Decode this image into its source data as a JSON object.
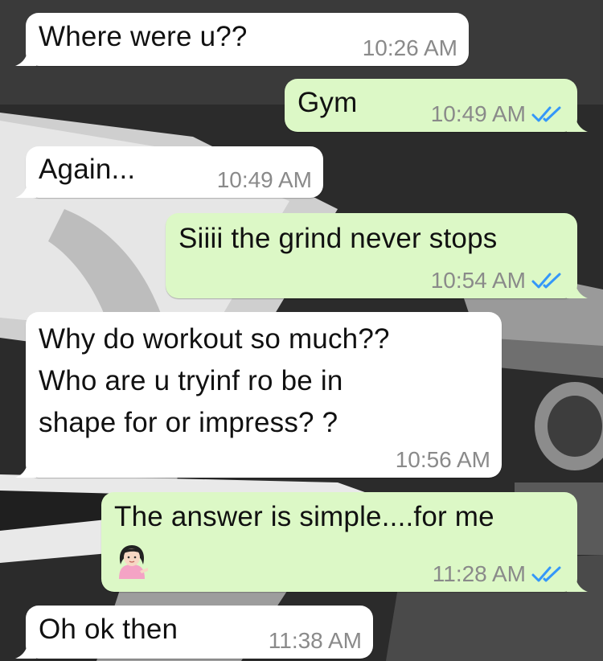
{
  "messages": [
    {
      "direction": "incoming",
      "text": "Where were u??",
      "time": "10:26 AM"
    },
    {
      "direction": "outgoing",
      "text": "Gym",
      "time": "10:49 AM",
      "status": "read"
    },
    {
      "direction": "incoming",
      "text": "Again...",
      "time": "10:49 AM"
    },
    {
      "direction": "outgoing",
      "text": "Siiii the grind never stops",
      "time": "10:54 AM",
      "status": "read"
    },
    {
      "direction": "incoming",
      "lines": [
        "Why do workout so much??",
        "Who are u tryinf ro be in",
        "shape for or impress? ?"
      ],
      "time": "10:56 AM"
    },
    {
      "direction": "outgoing",
      "text": "The answer is simple....for me",
      "emoji": "woman-tipping-hand-emoji",
      "time": "11:28 AM",
      "status": "read"
    },
    {
      "direction": "incoming",
      "text": "Oh ok then",
      "time": "11:38 AM"
    }
  ],
  "icons": {
    "read_receipt": "double-check-icon"
  },
  "colors": {
    "incoming_bubble": "#ffffff",
    "outgoing_bubble": "#dcf8c6",
    "timestamp": "#8a8a8a",
    "read_tick": "#3497f9"
  }
}
